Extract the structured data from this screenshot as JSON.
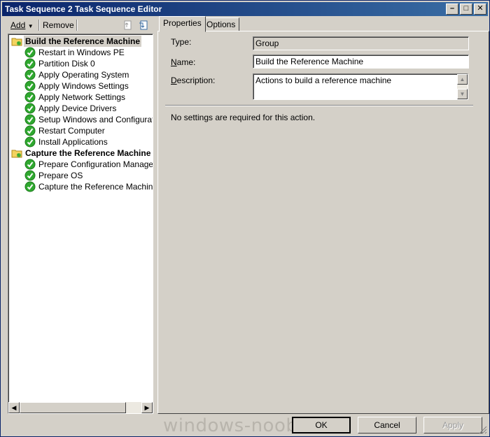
{
  "window": {
    "title": "Task Sequence 2 Task Sequence Editor",
    "controls": [
      "minimize-icon",
      "maximize-icon",
      "close-icon"
    ]
  },
  "toolbar": {
    "add_label": "Add",
    "remove_label": "Remove",
    "icons": [
      "move-up-icon",
      "move-down-icon"
    ]
  },
  "tree": {
    "groups": [
      {
        "label": "Build the Reference Machine",
        "selected": true,
        "steps": [
          "Restart in Windows PE",
          "Partition Disk 0",
          "Apply Operating System",
          "Apply Windows Settings",
          "Apply Network Settings",
          "Apply Device Drivers",
          "Setup Windows and Configuration",
          "Restart Computer",
          "Install Applications"
        ]
      },
      {
        "label": "Capture the Reference Machine",
        "selected": false,
        "steps": [
          "Prepare Configuration Manager Cli",
          "Prepare OS",
          "Capture the Reference Machine"
        ]
      }
    ]
  },
  "tabs": [
    {
      "label": "Properties",
      "active": true
    },
    {
      "label": "Options",
      "active": false
    }
  ],
  "properties": {
    "type_label": "Type:",
    "type_value": "Group",
    "name_label": "Name:",
    "name_value": "Build the Reference Machine",
    "description_label": "Description:",
    "description_value": "Actions to build a reference machine",
    "note": "No settings are required  for this action."
  },
  "buttons": {
    "ok": "OK",
    "cancel": "Cancel",
    "apply": "Apply"
  },
  "watermark": "windows-noob.com",
  "colors": {
    "titlebar_start": "#0a246a",
    "titlebar_end": "#3a6ea5",
    "face": "#d4d0c8",
    "check_green": "#2fa82f"
  }
}
